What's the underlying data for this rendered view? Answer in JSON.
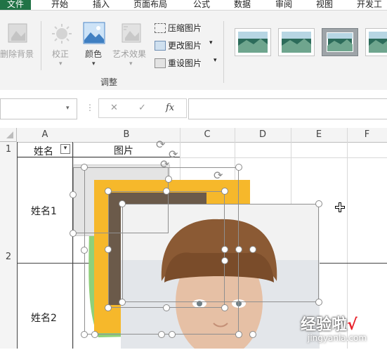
{
  "ribbon_tabs": [
    "文件",
    "开始",
    "插入",
    "页面布局",
    "公式",
    "数据",
    "审阅",
    "视图",
    "开发工"
  ],
  "ribbon": {
    "remove_bg": "删除背景",
    "correct": "校正",
    "color": "颜色",
    "art_effects": "艺术效果",
    "compress": "压缩图片",
    "change": "更改图片",
    "reset": "重设图片",
    "group_label": "调整"
  },
  "formula_bar": {
    "cancel": "✕",
    "enter": "✓",
    "fx": "fx"
  },
  "columns": [
    "A",
    "B",
    "C",
    "D",
    "E",
    "F"
  ],
  "rows": [
    "1",
    "2"
  ],
  "cells": {
    "A1": "姓名",
    "B1": "图片",
    "A2": "姓名1",
    "A3": "姓名2"
  },
  "watermark": {
    "main": "经验啦",
    "check": "√",
    "url": "jingyanla.com"
  },
  "colors": {
    "excel_green": "#217346",
    "frame_yellow": "#f6b82b",
    "blob_green": "#8fd07a"
  }
}
